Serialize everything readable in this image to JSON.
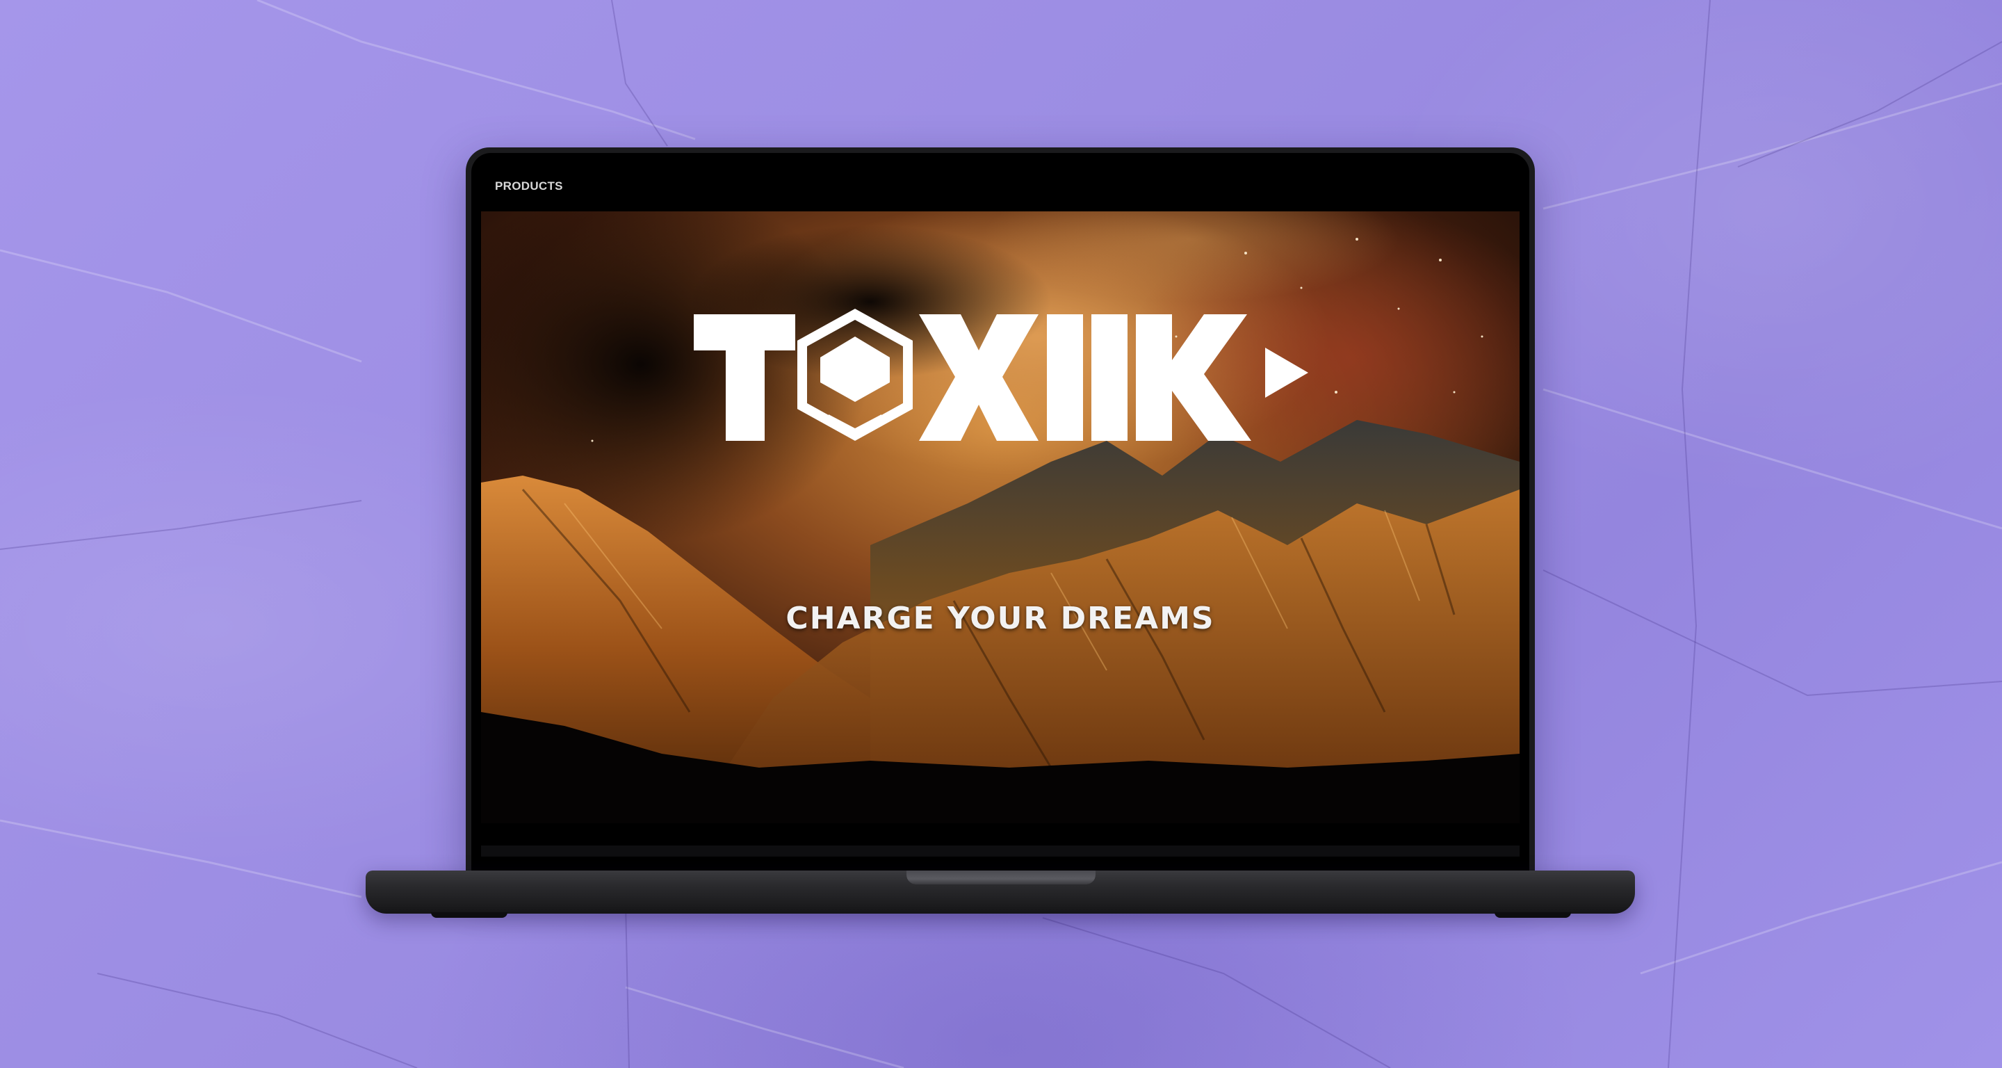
{
  "nav": {
    "products_label": "PRODUCTS"
  },
  "hero": {
    "logo_text": "TOXIIK",
    "tagline": "CHARGE YOUR DREAMS"
  },
  "colors": {
    "background": "#9d8ee4",
    "logo": "#ffffff",
    "sky_orange": "#c2702c",
    "mountain_gold": "#b86a22"
  },
  "icons": {
    "logo_emblem": "hexagon-helmet-icon",
    "logo_arrow": "play-triangle-icon"
  }
}
